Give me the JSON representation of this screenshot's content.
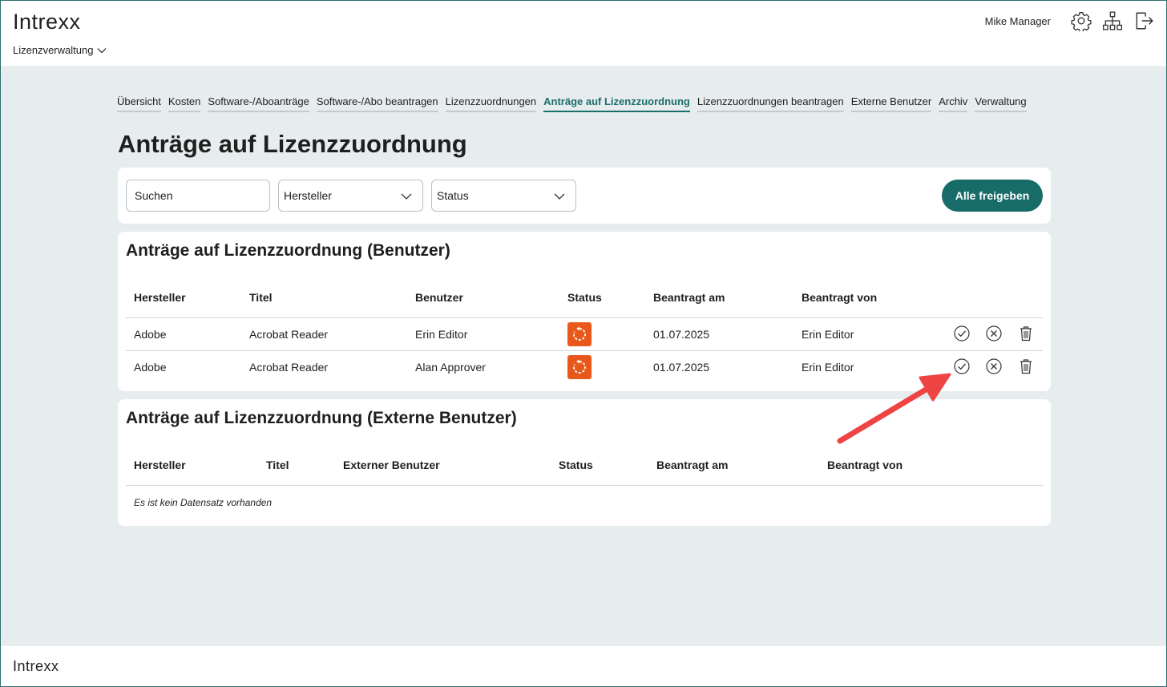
{
  "header": {
    "logo": "Intrexx",
    "app_menu": "Lizenzverwaltung",
    "user_name": "Mike Manager"
  },
  "tabs": [
    {
      "label": "Übersicht",
      "active": false
    },
    {
      "label": "Kosten",
      "active": false
    },
    {
      "label": "Software-/Aboanträge",
      "active": false
    },
    {
      "label": "Software-/Abo beantragen",
      "active": false
    },
    {
      "label": "Lizenzzuordnungen",
      "active": false
    },
    {
      "label": "Anträge auf Lizenzzuordnung",
      "active": true
    },
    {
      "label": "Lizenzzuordnungen beantragen",
      "active": false
    },
    {
      "label": "Externe Benutzer",
      "active": false
    },
    {
      "label": "Archiv",
      "active": false
    },
    {
      "label": "Verwaltung",
      "active": false
    }
  ],
  "page_title": "Anträge auf Lizenzzuordnung",
  "filters": {
    "search_placeholder": "Suchen",
    "manufacturer_select": "Hersteller",
    "status_select": "Status",
    "approve_all_label": "Alle freigeben"
  },
  "users_table": {
    "title": "Anträge auf Lizenzzuordnung (Benutzer)",
    "columns": [
      "Hersteller",
      "Titel",
      "Benutzer",
      "Status",
      "Beantragt am",
      "Beantragt von"
    ],
    "rows": [
      {
        "hersteller": "Adobe",
        "titel": "Acrobat Reader",
        "benutzer": "Erin Editor",
        "status_icon": "pending-icon",
        "beantragt_am": "01.07.2025",
        "beantragt_von": "Erin Editor"
      },
      {
        "hersteller": "Adobe",
        "titel": "Acrobat Reader",
        "benutzer": "Alan Approver",
        "status_icon": "pending-icon",
        "beantragt_am": "01.07.2025",
        "beantragt_von": "Erin Editor"
      }
    ]
  },
  "external_table": {
    "title": "Anträge auf Lizenzzuordnung (Externe Benutzer)",
    "columns": [
      "Hersteller",
      "Titel",
      "Externer Benutzer",
      "Status",
      "Beantragt am",
      "Beantragt von"
    ],
    "empty_message": "Es ist kein Datensatz vorhanden"
  },
  "footer": {
    "logo": "Intrexx"
  },
  "colors": {
    "accent": "#176b69",
    "status_pending": "#e8581b",
    "annotation_arrow": "#ef4444",
    "background": "#e7ecee"
  }
}
